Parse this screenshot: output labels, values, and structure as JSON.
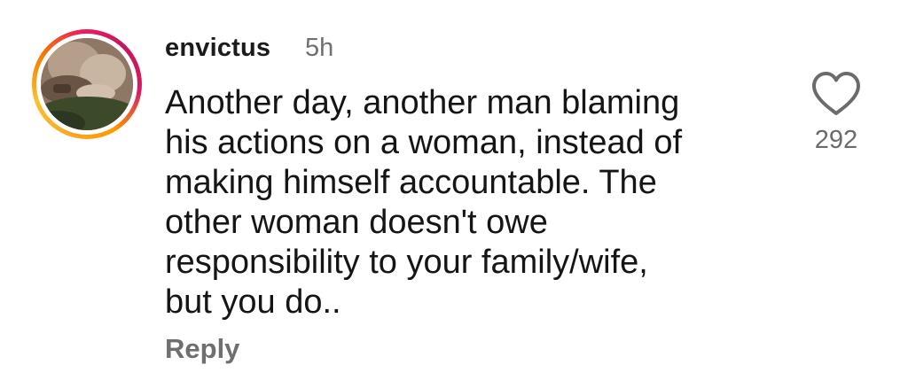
{
  "comment": {
    "username": "envictus",
    "timestamp": "5h",
    "text": "Another day, another man blaming\nhis actions on a woman, instead of\nmaking himself accountable. The\nother woman doesn't owe\nresponsibility to your family/wife,\nbut you do..",
    "reply_label": "Reply",
    "like_icon": "heart-outline-icon",
    "like_count": "292",
    "avatar_ring_colors": [
      "#f9a825",
      "#f57c00",
      "#e91e63",
      "#c2185b"
    ]
  }
}
